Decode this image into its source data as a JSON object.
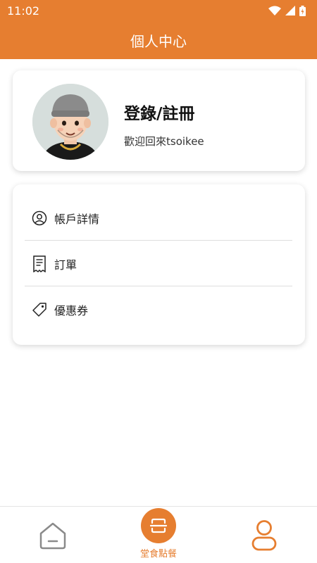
{
  "status_bar": {
    "time": "11:02"
  },
  "header": {
    "title": "個人中心"
  },
  "profile": {
    "login_label": "登錄/註冊",
    "welcome_text": "歡迎回來tsoikee"
  },
  "menu": {
    "items": [
      {
        "label": "帳戶詳情",
        "icon": "user-circle-icon"
      },
      {
        "label": "訂單",
        "icon": "receipt-icon"
      },
      {
        "label": "優惠券",
        "icon": "tag-icon"
      }
    ]
  },
  "bottom_nav": {
    "center_label": "堂食點餐"
  },
  "colors": {
    "accent": "#e67e30",
    "nav_inactive": "#8a8a8a"
  }
}
